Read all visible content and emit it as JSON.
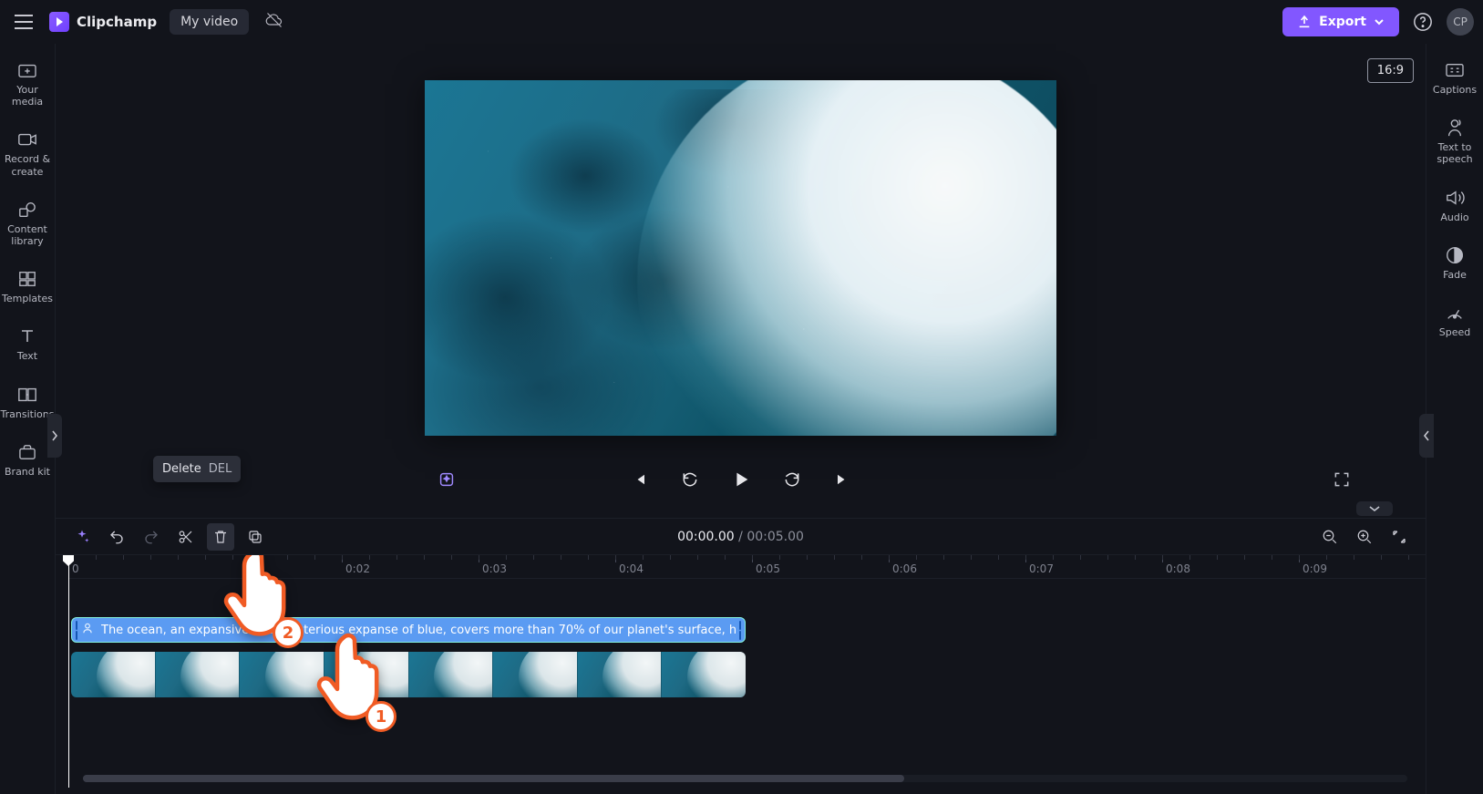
{
  "app": {
    "name": "Clipchamp",
    "video_name": "My video"
  },
  "header": {
    "export_label": "Export",
    "avatar_initials": "CP"
  },
  "left_rail": {
    "items": [
      {
        "label": "Your media"
      },
      {
        "label": "Record & create"
      },
      {
        "label": "Content library"
      },
      {
        "label": "Templates"
      },
      {
        "label": "Text"
      },
      {
        "label": "Transitions"
      },
      {
        "label": "Brand kit"
      }
    ]
  },
  "right_rail": {
    "aspect": "16:9",
    "items": [
      {
        "label": "Captions"
      },
      {
        "label": "Text to speech"
      },
      {
        "label": "Audio"
      },
      {
        "label": "Fade"
      },
      {
        "label": "Speed"
      }
    ]
  },
  "tooltip": {
    "label": "Delete",
    "kbd": "DEL"
  },
  "time": {
    "current": "00:00.00",
    "total": "00:05.00",
    "sep": "/"
  },
  "timeline": {
    "ticks": [
      "0",
      "0:02",
      "0:03",
      "0:04",
      "0:05",
      "0:06",
      "0:07",
      "0:08",
      "0:09"
    ],
    "tts_text": "The ocean, an expansive and mysterious expanse of blue, covers more than 70% of our planet's surface, holding within its dept"
  },
  "annotations": {
    "step1": "1",
    "step2": "2"
  }
}
